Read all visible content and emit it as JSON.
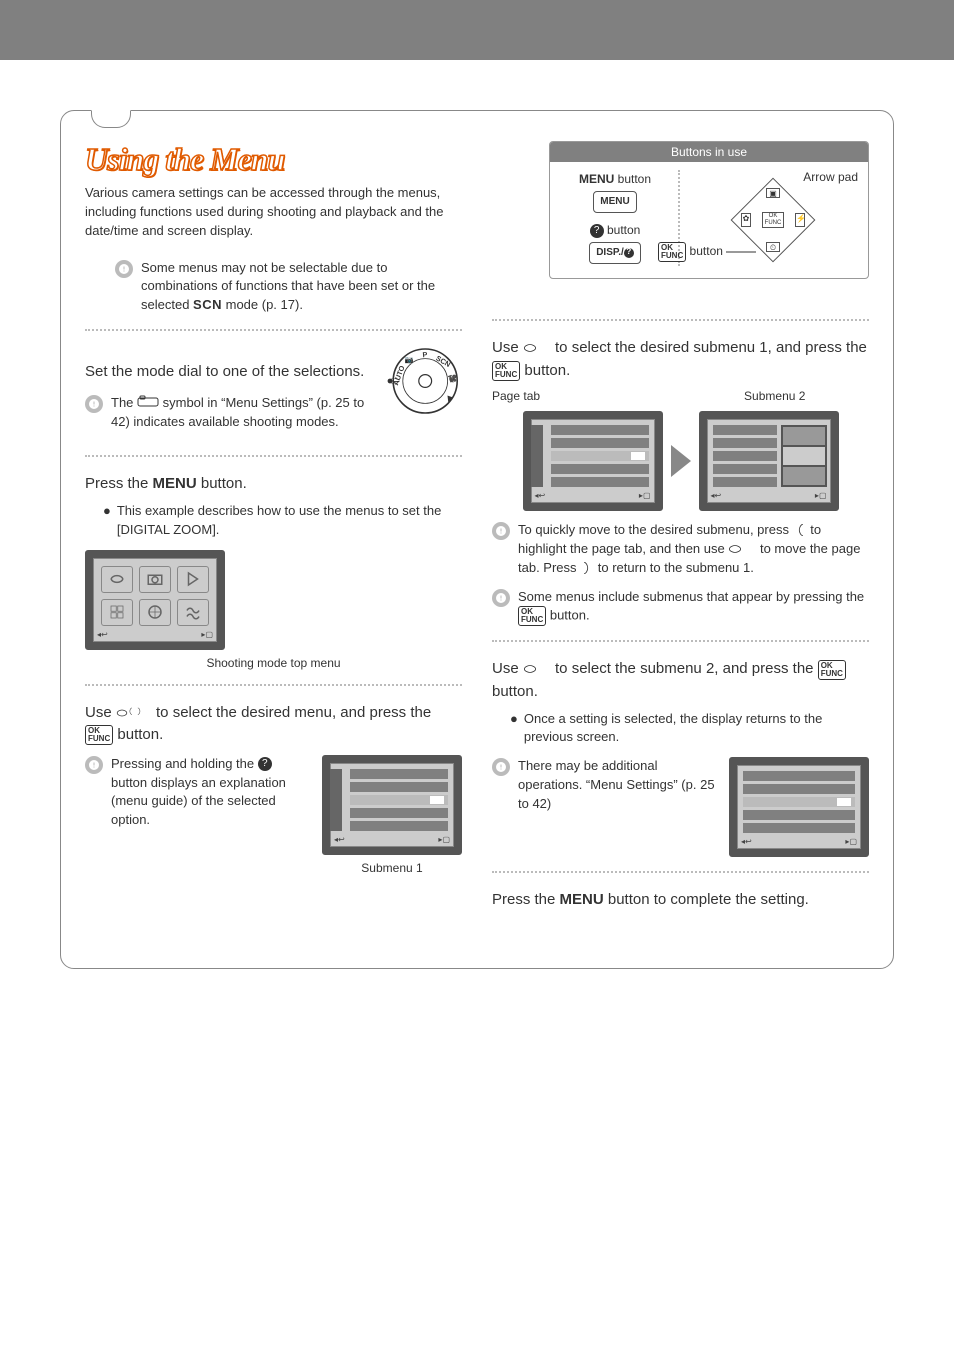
{
  "page": {
    "title": "Using the Menu",
    "intro": "Various camera settings can be accessed through the menus, including functions used during shooting and playback and the date/time and screen display.",
    "note_top": "Some menus may not be selectable due to combinations of functions that have been set or the selected ",
    "note_top_scn": "SCN",
    "note_top_tail": " mode (p. 17).",
    "step1_head": "Set the mode dial to one of the selections.",
    "step1_note_a": "The ",
    "step1_note_b": " symbol in “Menu Settings” (p. 25 to 42) indicates available shooting modes.",
    "step2_head_a": "Press the ",
    "step2_head_menu": "MENU",
    "step2_head_b": " button.",
    "step2_bullet": "This example describes how to use the menus to set the [DIGITAL ZOOM].",
    "fig1_caption": "Shooting mode top menu",
    "step3_head_a": "Use ",
    "step3_head_b": " to select the desired menu, and press the ",
    "step3_head_c": " button.",
    "step3_note": "Pressing and holding the ",
    "step3_note_b": " button displays an explanation (menu guide) of the selected option.",
    "fig2_caption": "Submenu 1",
    "biu_title": "Buttons in use",
    "biu_menu_label": "MENU",
    "biu_menu_btn_label": " button",
    "biu_menu_token": "MENU",
    "biu_q_label": " button",
    "biu_disp_token": "DISP./",
    "biu_arrowpad": "Arrow pad",
    "biu_ok_label": " button",
    "step4_head_a": "Use ",
    "step4_head_b": " to select the desired submenu 1, and press the ",
    "step4_head_c": " button.",
    "lbl_pagetab": "Page tab",
    "lbl_submenu2": "Submenu 2",
    "step4_note1_a": "To quickly move to the desired submenu, press ",
    "step4_note1_b": " to highlight the page tab, and then use ",
    "step4_note1_c": " to move the page tab. Press ",
    "step4_note1_d": " to return to the submenu 1.",
    "step4_note2": "Some menus include submenus that appear by pressing the ",
    "step4_note2_b": " button.",
    "step5_head_a": "Use ",
    "step5_head_b": " to select the submenu 2, and press the ",
    "step5_head_c": " button.",
    "step5_bullet": "Once a setting is selected, the display returns to the previous screen.",
    "step5_note": "There may be additional operations. “Menu Settings” (p. 25 to 42)",
    "step6_a": "Press the ",
    "step6_menu": "MENU",
    "step6_b": " button to complete the setting.",
    "ok_text": "OK\nFUNC"
  }
}
